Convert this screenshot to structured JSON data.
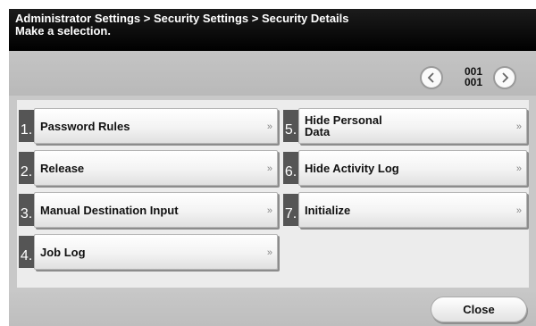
{
  "header": {
    "breadcrumb": "Administrator Settings > Security Settings > Security Details",
    "instruction": "Make a selection."
  },
  "pagination": {
    "current": "001",
    "total": "001",
    "prev_icon": "chevron-left-icon",
    "next_icon": "chevron-right-icon"
  },
  "items": [
    {
      "number": "1.",
      "label": "Password Rules"
    },
    {
      "number": "2.",
      "label": "Release"
    },
    {
      "number": "3.",
      "label": "Manual Destination Input"
    },
    {
      "number": "4.",
      "label": "Job Log"
    },
    {
      "number": "5.",
      "label": "Hide Personal\nData"
    },
    {
      "number": "6.",
      "label": "Hide Activity Log"
    },
    {
      "number": "7.",
      "label": "Initialize"
    }
  ],
  "item_arrow": "»",
  "footer": {
    "close_label": "Close"
  }
}
